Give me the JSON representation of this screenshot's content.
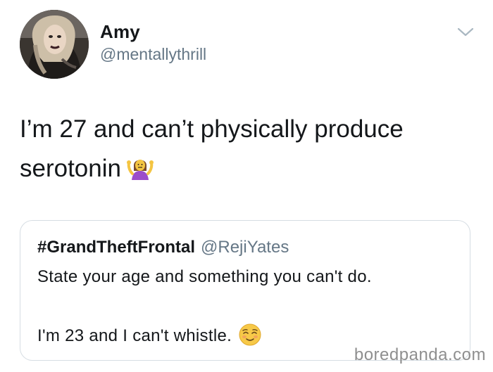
{
  "tweet": {
    "display_name": "Amy",
    "handle": "@mentallythrill",
    "text_line1": "I’m 27 and can’t physically produce",
    "text_line2": "serotonin",
    "emoji": "person-shrugging-icon"
  },
  "quoted_tweet": {
    "display_name": "#GrandTheftFrontal",
    "handle": "@RejiYates",
    "line1": "State your age and something you can't do.",
    "line2": "I'm 23 and I can't whistle.",
    "emoji": "relieved-face-icon"
  },
  "watermark": "boredpanda.com",
  "colors": {
    "text": "#14171a",
    "secondary": "#657786",
    "border": "#d6dde3",
    "chevron": "#aab8c2",
    "watermark": "#8f8f8f"
  }
}
